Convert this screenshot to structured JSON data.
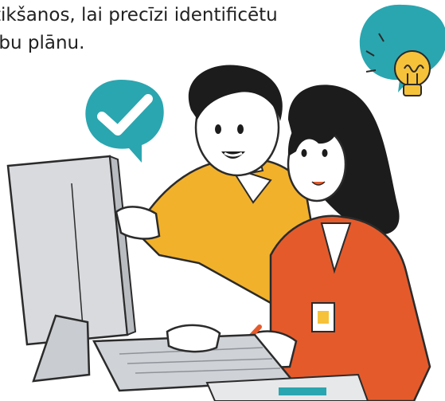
{
  "caption": {
    "line_1": "tikšanos, lai precīzi identificētu",
    "line_2": "ību plānu."
  },
  "illustration": {
    "checkmark_bubble_color": "#2aa6b0",
    "lightbulb_bubble_color": "#2aa6b0",
    "lightbulb_color": "#f6c23a",
    "man_shirt_color": "#f2b12b",
    "woman_jacket_color": "#e55a2b",
    "monitor_color": "#d8dadd",
    "hair_color": "#1c1c1c",
    "skin_color": "#ffffff",
    "icons": [
      "check-icon",
      "lightbulb-icon"
    ]
  }
}
